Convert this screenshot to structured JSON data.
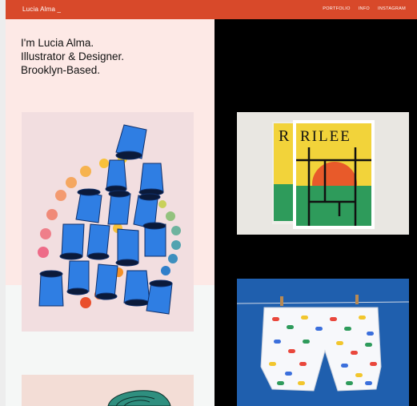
{
  "header": {
    "brand": "Lucia Alma _",
    "nav": [
      "PORTFOLIO",
      "INFO",
      "INSTAGRAM"
    ]
  },
  "intro": {
    "lines": [
      "I'm Lucia Alma.",
      "Illustrator & Designer.",
      "Brooklyn-Based."
    ]
  },
  "artwork": {
    "magazine_title": "RILEE",
    "magazine_title_back": "R"
  },
  "colors": {
    "header": "#d8492a",
    "left_panel": "#fde9e6",
    "right_panel": "#000000",
    "cup_blue": "#2f7ee3",
    "magazine_yellow": "#f2d33a",
    "sky_blue": "#1f5fae"
  }
}
